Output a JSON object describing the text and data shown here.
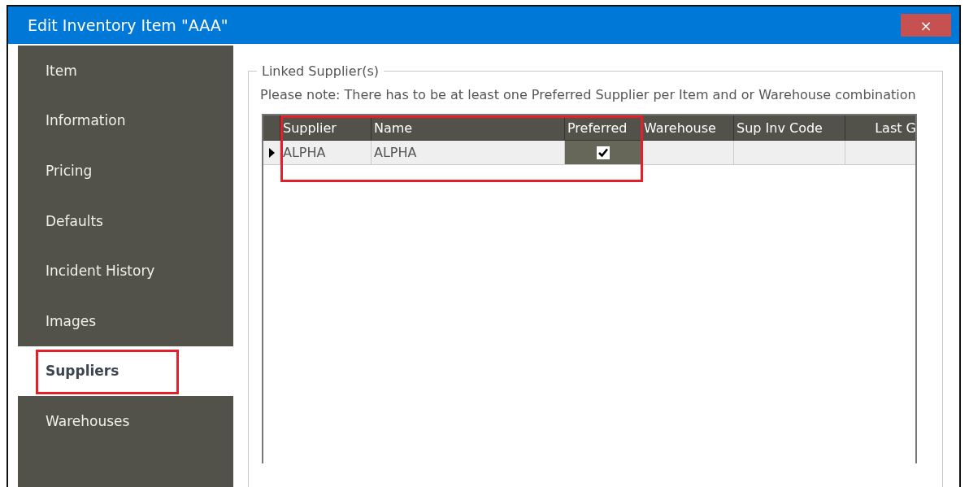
{
  "window": {
    "title": "Edit Inventory Item \"AAA\"",
    "close": "×"
  },
  "sidebar": {
    "items": [
      {
        "label": "Item",
        "selected": false,
        "highlighted": false
      },
      {
        "label": "Information",
        "selected": false,
        "highlighted": false
      },
      {
        "label": "Pricing",
        "selected": false,
        "highlighted": false
      },
      {
        "label": "Defaults",
        "selected": false,
        "highlighted": false
      },
      {
        "label": "Incident History",
        "selected": false,
        "highlighted": false
      },
      {
        "label": "Images",
        "selected": false,
        "highlighted": false
      },
      {
        "label": "Suppliers",
        "selected": true,
        "highlighted": true
      },
      {
        "label": "Warehouses",
        "selected": false,
        "highlighted": false
      }
    ]
  },
  "group": {
    "title": "Linked Supplier(s)",
    "note": "Please note:  There has to be at least one Preferred Supplier per Item and or Warehouse combination"
  },
  "table": {
    "columns": [
      {
        "label": "Supplier",
        "highlighted": true
      },
      {
        "label": "Name",
        "highlighted": true
      },
      {
        "label": "Preferred",
        "highlighted": true
      },
      {
        "label": "Warehouse",
        "highlighted": false
      },
      {
        "label": "Sup Inv Code",
        "highlighted": false
      },
      {
        "label": "Last G",
        "highlighted": false
      }
    ],
    "rows": [
      {
        "current": true,
        "cells": [
          {
            "kind": "text",
            "text": "ALPHA"
          },
          {
            "kind": "text",
            "text": "ALPHA"
          },
          {
            "kind": "check",
            "checked": true,
            "selected": true
          },
          {
            "kind": "text",
            "text": ""
          },
          {
            "kind": "text",
            "text": ""
          },
          {
            "kind": "text",
            "text": ""
          }
        ]
      }
    ]
  }
}
